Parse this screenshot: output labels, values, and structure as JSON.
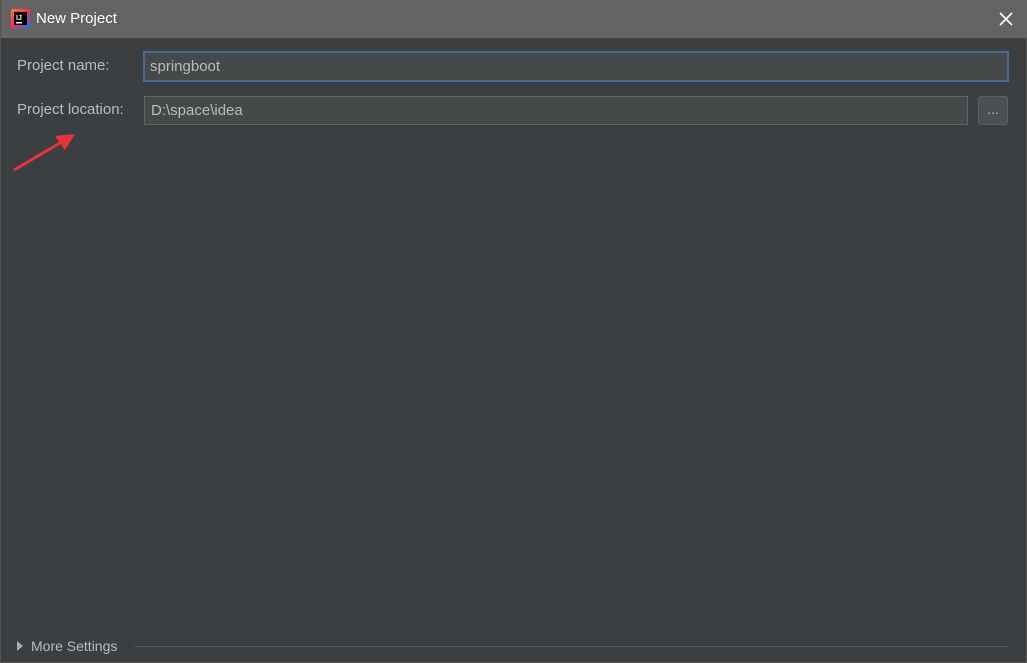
{
  "window": {
    "title": "New Project",
    "app_icon": "intellij-idea-icon",
    "close_icon": "close-icon"
  },
  "form": {
    "project_name": {
      "label": "Project name:",
      "value": "springboot"
    },
    "project_location": {
      "label": "Project location:",
      "value": "D:\\space\\idea",
      "browse_label": "..."
    }
  },
  "footer": {
    "more_settings_label": "More Settings",
    "expand_icon": "triangle-right-icon"
  },
  "annotation": {
    "arrow_color": "#e8333a"
  },
  "colors": {
    "background": "#3c3f41",
    "titlebar": "#636363",
    "field_bg": "#45494a",
    "focus_border": "#466d94",
    "text": "#bbbbbb"
  }
}
